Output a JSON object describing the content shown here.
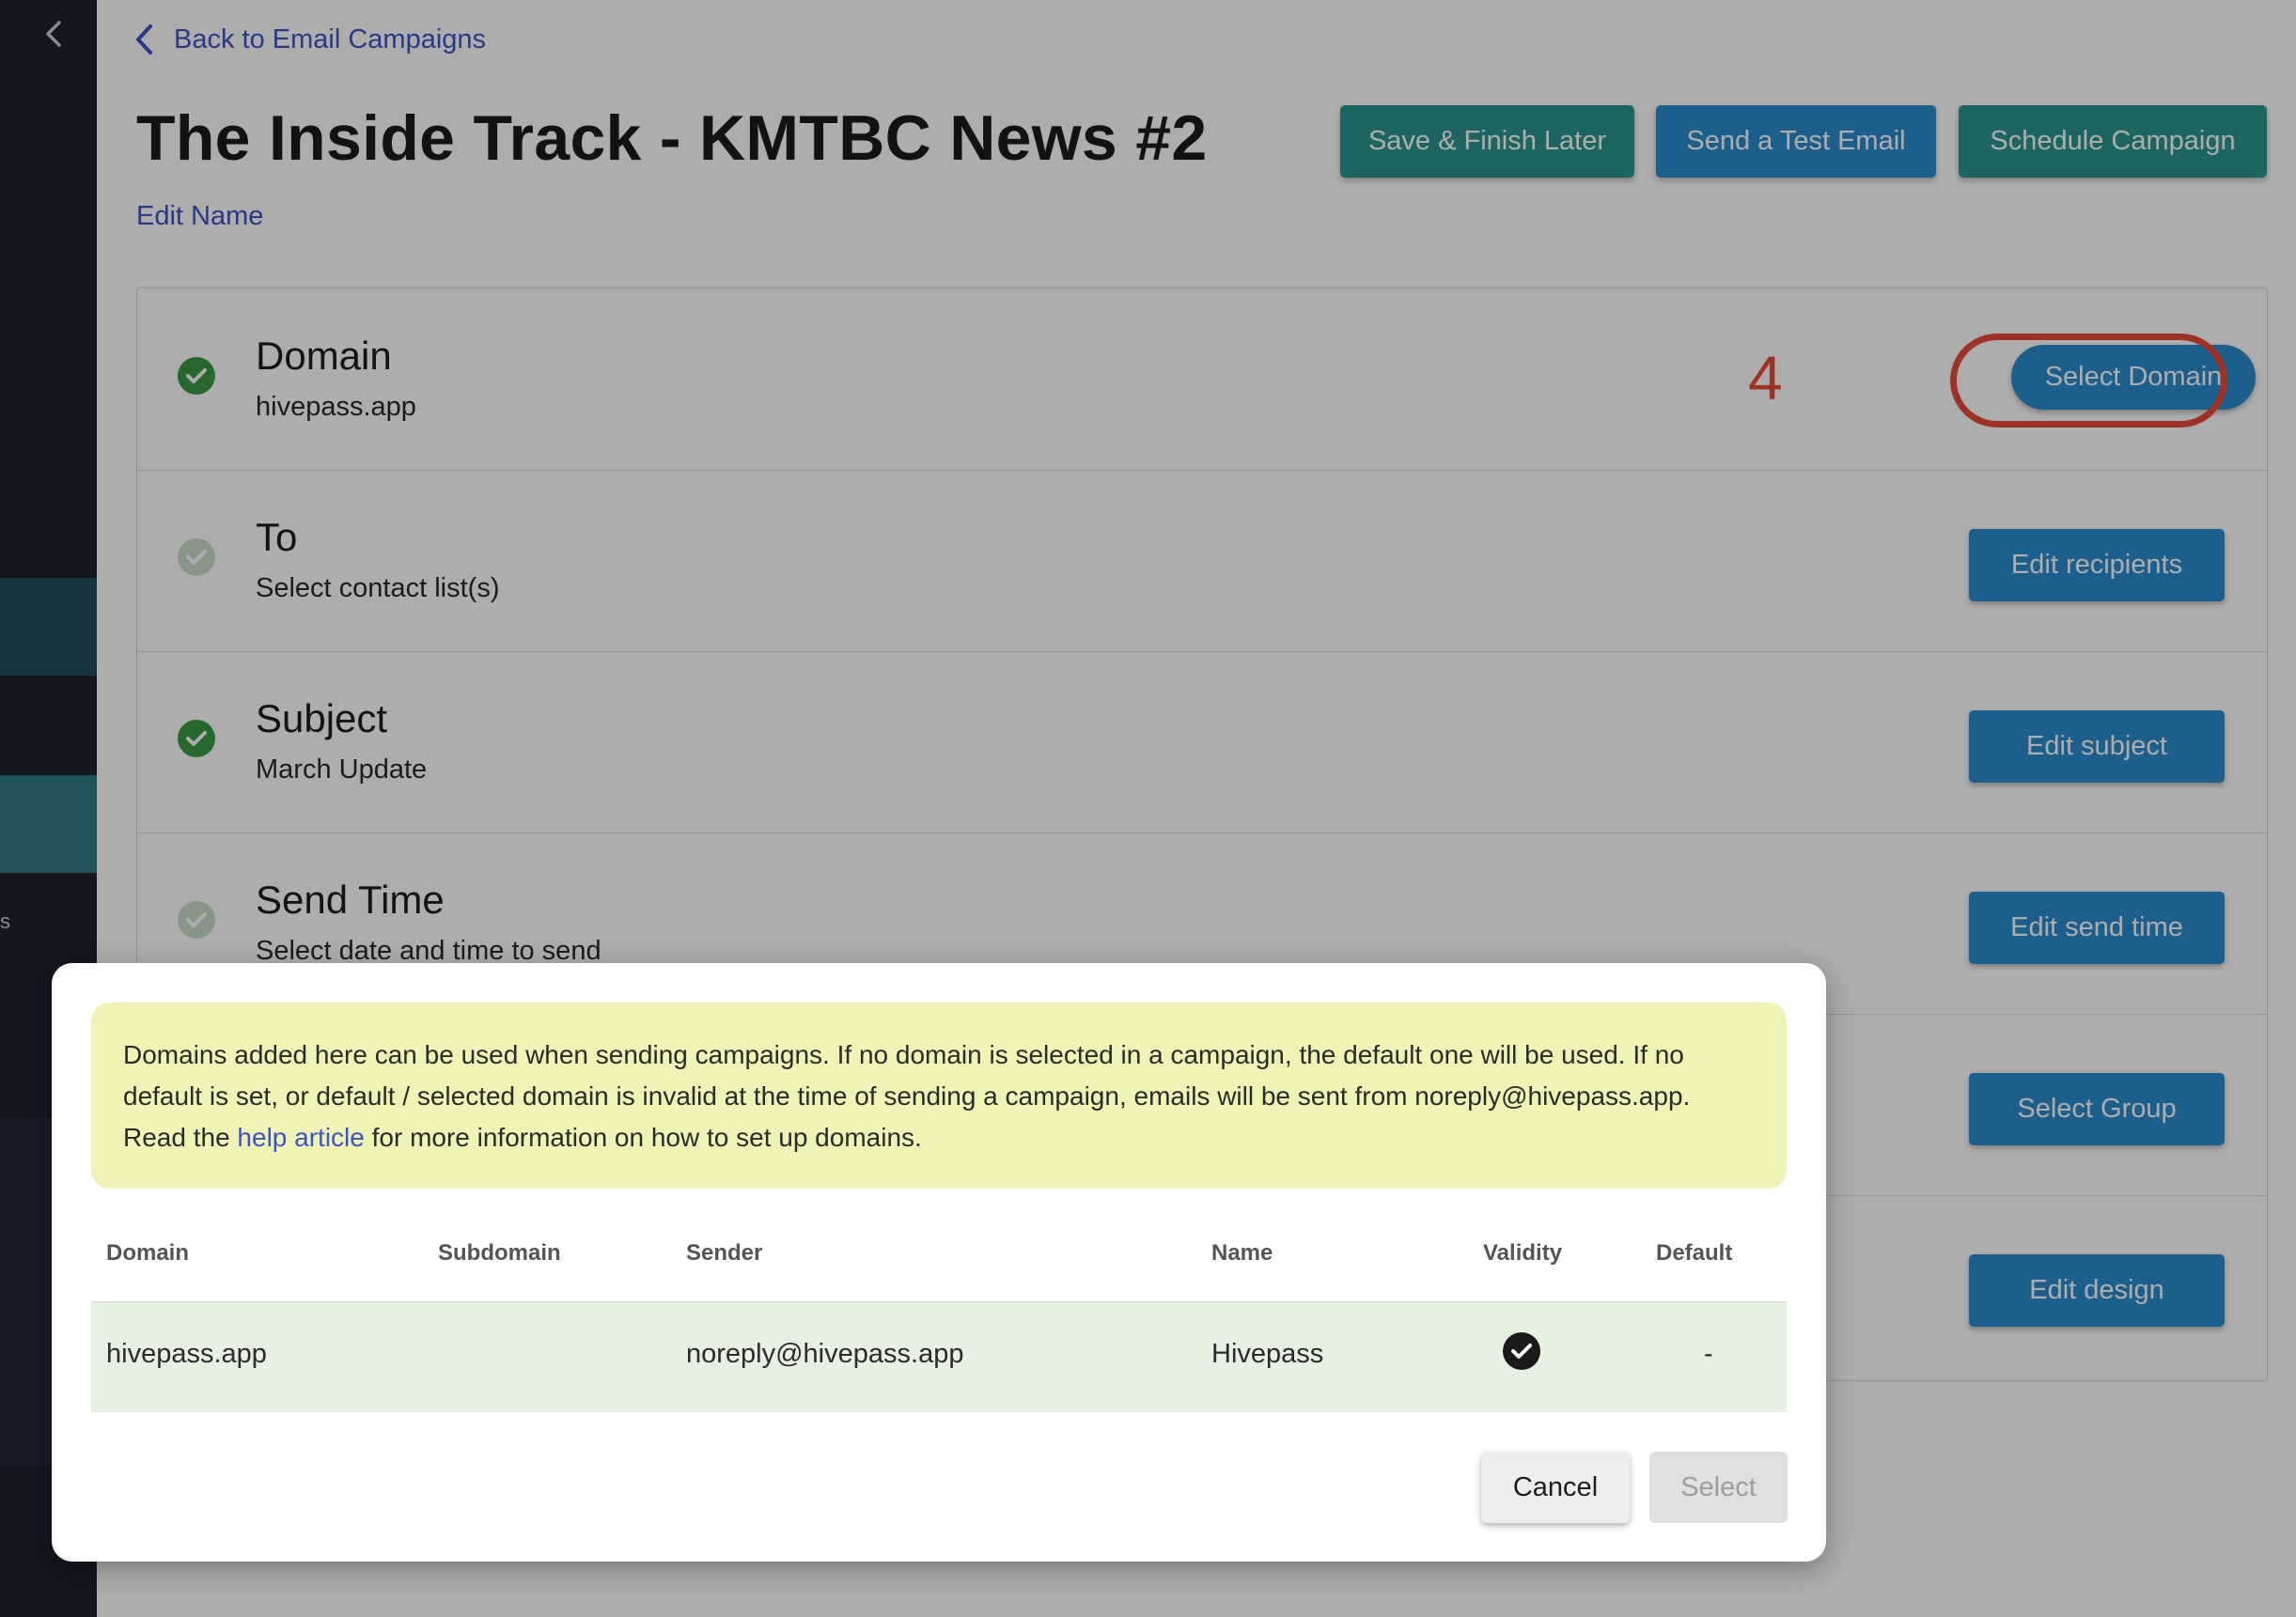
{
  "nav": {
    "back_label": "Back to Email Campaigns",
    "sidebar_letter": "s"
  },
  "header": {
    "title": "The Inside Track - KMTBC News #2",
    "edit_name": "Edit Name",
    "save_label": "Save & Finish Later",
    "test_label": "Send a Test Email",
    "schedule_label": "Schedule Campaign"
  },
  "steps": [
    {
      "title": "Domain",
      "subtitle": "hivepass.app",
      "button": "Select Domain",
      "complete": true
    },
    {
      "title": "To",
      "subtitle": "Select contact list(s)",
      "button": "Edit recipients",
      "complete": false
    },
    {
      "title": "Subject",
      "subtitle": "March Update",
      "button": "Edit subject",
      "complete": true
    },
    {
      "title": "Send Time",
      "subtitle": "Select date and time to send",
      "button": "Edit send time",
      "complete": false
    },
    {
      "title": "",
      "subtitle": "",
      "button": "Select Group",
      "complete": false
    },
    {
      "title": "",
      "subtitle": "",
      "button": "Edit design",
      "complete": false
    }
  ],
  "annotation": {
    "step_number": "4"
  },
  "modal": {
    "notice_text": "Domains added here can be used when sending campaigns. If no domain is selected in a campaign, the default one will be used. If no default is set, or default / selected domain is invalid at the time of sending a campaign, emails will be sent from noreply@hivepass.app. Read the ",
    "notice_link": "help article",
    "notice_tail": " for more information on how to set up domains.",
    "columns": [
      "Domain",
      "Subdomain",
      "Sender",
      "Name",
      "Validity",
      "Default"
    ],
    "rows": [
      {
        "domain": "hivepass.app",
        "subdomain": "",
        "sender": "noreply@hivepass.app",
        "name": "Hivepass",
        "valid": true,
        "default": "-"
      }
    ],
    "cancel_label": "Cancel",
    "select_label": "Select"
  },
  "colors": {
    "accent_teal": "#2a968f",
    "accent_blue": "#2b8ccf",
    "highlight_red": "#e84a3a",
    "success_green": "#3a9a45",
    "notice_bg": "#f1f2b5",
    "row_bg": "#e5f1e1"
  }
}
